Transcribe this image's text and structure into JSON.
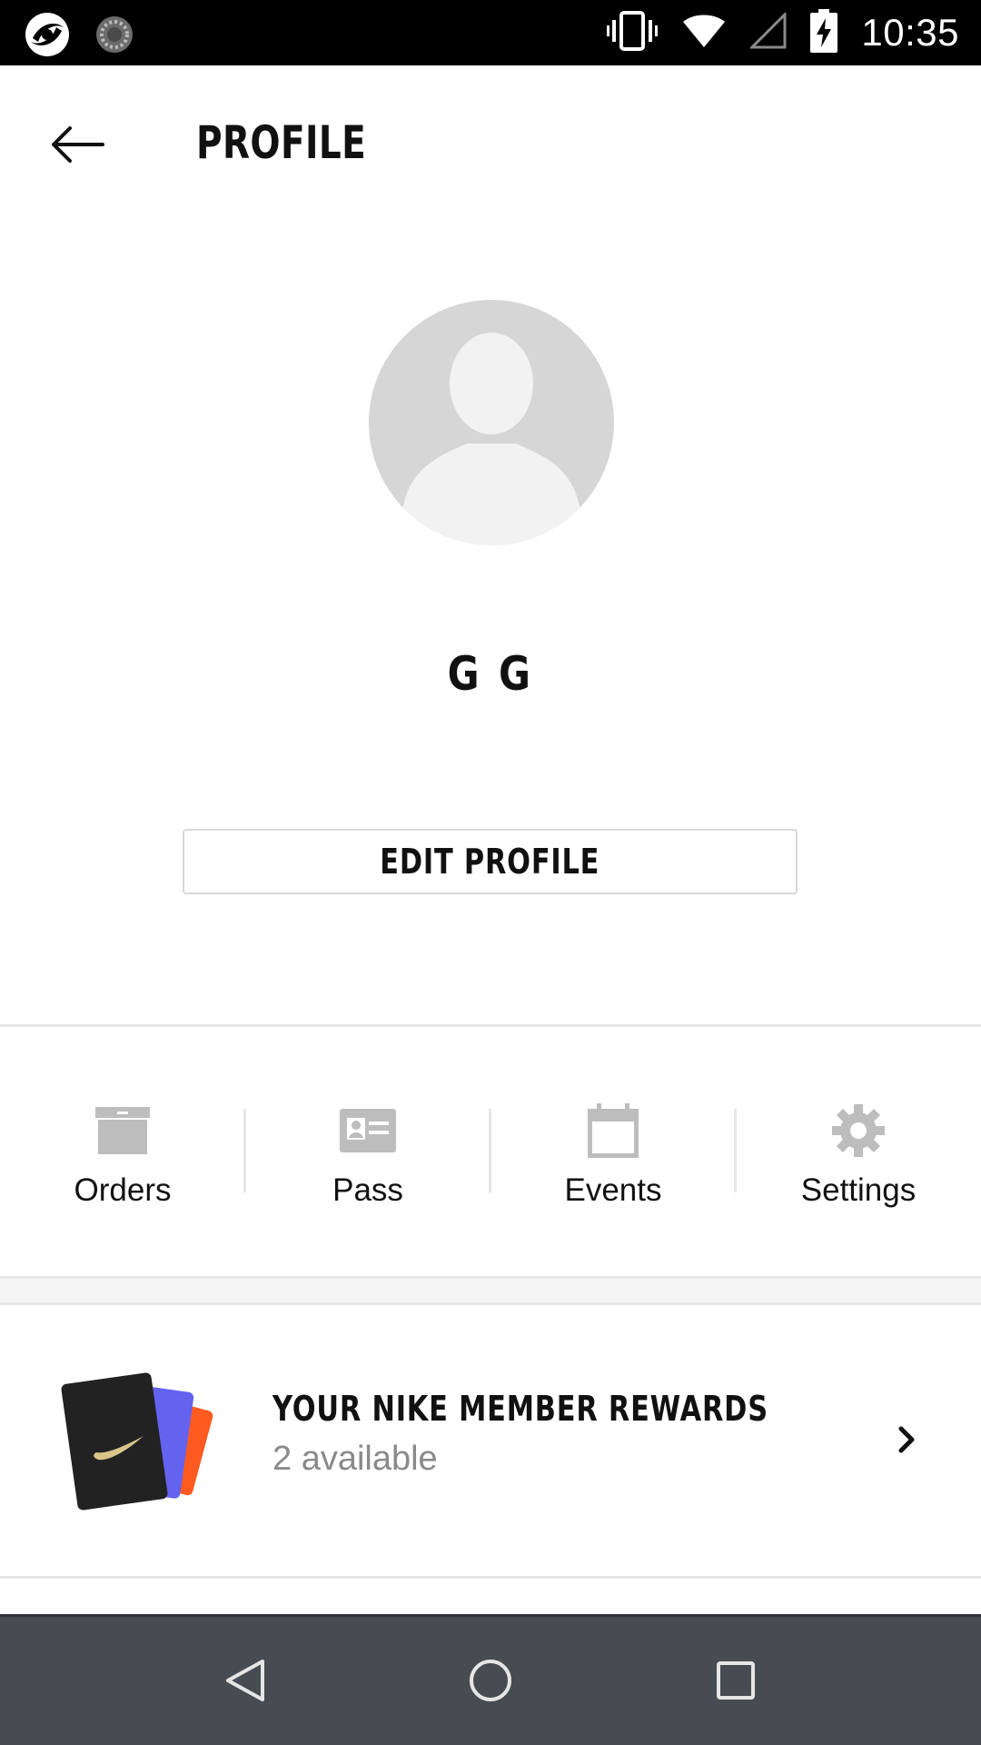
{
  "status_bar": {
    "time": "10:35",
    "icons": [
      "app-notification-icon",
      "loading-notification-icon",
      "vibrate-icon",
      "wifi-icon",
      "cell-signal-icon",
      "battery-charging-icon"
    ]
  },
  "appbar": {
    "back_icon": "arrow-left-icon",
    "title": "PROFILE"
  },
  "profile": {
    "avatar_icon": "person-placeholder-icon",
    "name": "G  G",
    "edit_button": "EDIT PROFILE"
  },
  "quick_links": [
    {
      "label": "Orders",
      "icon": "box-icon"
    },
    {
      "label": "Pass",
      "icon": "id-card-icon"
    },
    {
      "label": "Events",
      "icon": "calendar-icon"
    },
    {
      "label": "Settings",
      "icon": "gear-icon"
    }
  ],
  "rewards": {
    "title": "YOUR NIKE MEMBER REWARDS",
    "subtitle": "2 available",
    "icon": "reward-cards-icon",
    "chevron_icon": "chevron-right-icon"
  },
  "nav_bar": {
    "back_icon": "nav-back-icon",
    "home_icon": "nav-home-icon",
    "recents_icon": "nav-recents-icon"
  },
  "colors": {
    "status_bar": "#000000",
    "nav_bar": "#464c52",
    "icon_gray": "#bdbdbd",
    "avatar_bg": "#d6d6d6",
    "subtitle_gray": "#8a8a8a",
    "divider": "#e6e6e6"
  }
}
